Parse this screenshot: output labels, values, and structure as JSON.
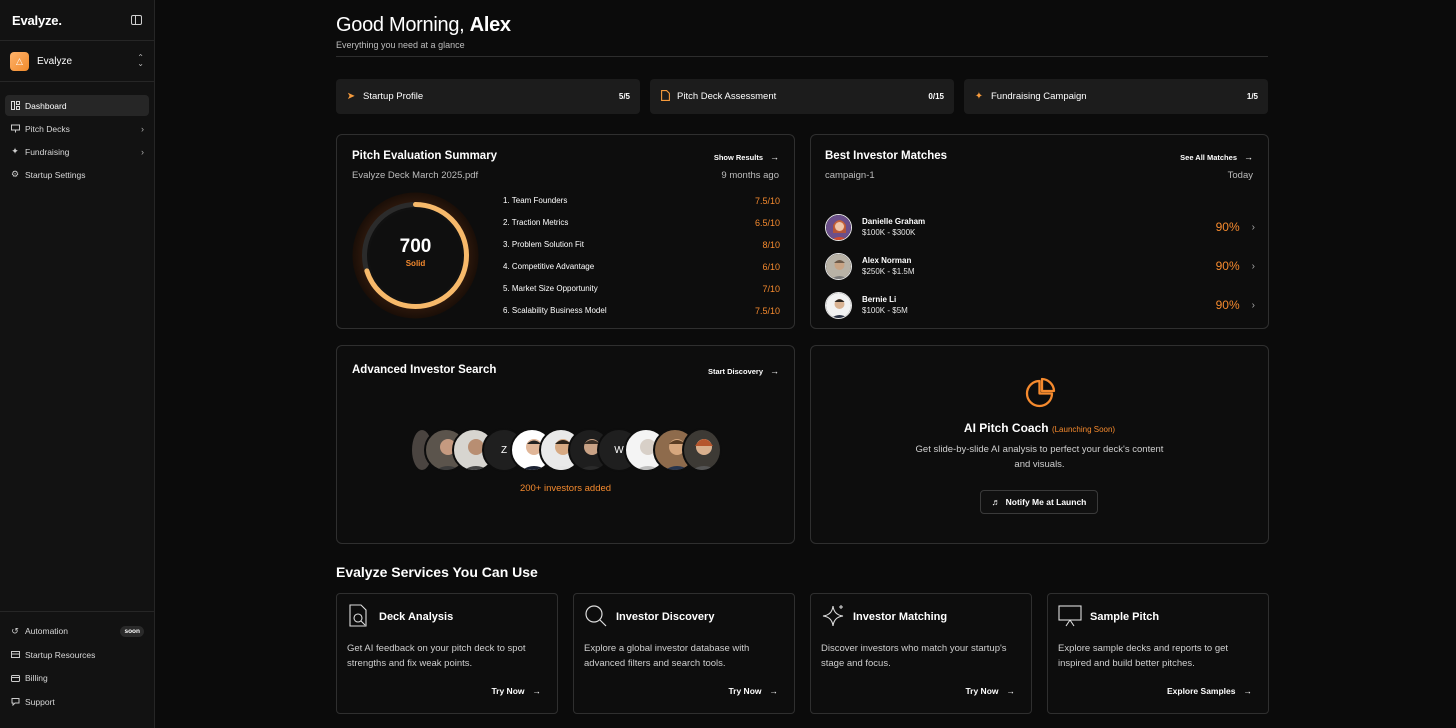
{
  "app": {
    "logo": "Evalyze",
    "logo_dot": "."
  },
  "workspace": {
    "name": "Evalyze",
    "icon": "bell-logo-icon",
    "accent": "#f08a2b"
  },
  "sidebar": {
    "items": [
      {
        "label": "Dashboard",
        "icon": "dashboard-icon",
        "active": true
      },
      {
        "label": "Pitch Decks",
        "icon": "presentation-icon",
        "chevron": true
      },
      {
        "label": "Fundraising",
        "icon": "sparkle-icon",
        "chevron": true
      },
      {
        "label": "Startup Settings",
        "icon": "gear-icon"
      }
    ],
    "bottom": [
      {
        "label": "Automation",
        "icon": "automation-icon",
        "badge": "soon"
      },
      {
        "label": "Startup Resources",
        "icon": "resources-icon"
      },
      {
        "label": "Billing",
        "icon": "card-icon"
      },
      {
        "label": "Support",
        "icon": "support-icon"
      }
    ]
  },
  "header": {
    "greeting": "Good Morning,",
    "name": "Alex",
    "subtitle": "Everything you need at a glance"
  },
  "progress": [
    {
      "label": "Startup Profile",
      "count": "5/5",
      "icon": "rocket-icon"
    },
    {
      "label": "Pitch Deck Assessment",
      "count": "0/15",
      "icon": "document-icon"
    },
    {
      "label": "Fundraising Campaign",
      "count": "1/5",
      "icon": "sparkle-icon"
    }
  ],
  "pitch_eval": {
    "title": "Pitch Evaluation Summary",
    "link": "Show Results",
    "file": "Evalyze Deck March 2025.pdf",
    "time": "9 months ago",
    "score": "700",
    "rating": "Solid",
    "score_fraction": 0.7,
    "metrics": [
      {
        "label": "1. Team Founders",
        "value": "7.5/10"
      },
      {
        "label": "2. Traction Metrics",
        "value": "6.5/10"
      },
      {
        "label": "3. Problem Solution Fit",
        "value": "8/10"
      },
      {
        "label": "4. Competitive Advantage",
        "value": "6/10"
      },
      {
        "label": "5. Market Size Opportunity",
        "value": "7/10"
      },
      {
        "label": "6. Scalability Business Model",
        "value": "7.5/10"
      }
    ]
  },
  "matches": {
    "title": "Best Investor Matches",
    "link": "See All Matches",
    "campaign": "campaign-1",
    "date": "Today",
    "investors": [
      {
        "name": "Danielle Graham",
        "range": "$100K - $300K",
        "pct": "90%"
      },
      {
        "name": "Alex Norman",
        "range": "$250K - $1.5M",
        "pct": "90%"
      },
      {
        "name": "Bernie Li",
        "range": "$100K - $5M",
        "pct": "90%"
      }
    ]
  },
  "search": {
    "title": "Advanced Investor Search",
    "link": "Start Discovery",
    "count_label": "200+ investors added",
    "letters": [
      "Z",
      "W"
    ]
  },
  "coach": {
    "title": "AI Pitch Coach",
    "soon": "(Launching Soon)",
    "desc": "Get slide-by-slide AI analysis to perfect your deck's content and visuals.",
    "button": "Notify Me at Launch"
  },
  "services": {
    "title": "Evalyze Services You Can Use",
    "items": [
      {
        "title": "Deck Analysis",
        "desc": "Get AI feedback on your pitch deck to spot strengths and fix weak points.",
        "action": "Try Now",
        "icon": "document-search-icon"
      },
      {
        "title": "Investor Discovery",
        "desc": "Explore a global investor database with advanced filters and search tools.",
        "action": "Try Now",
        "icon": "search-icon"
      },
      {
        "title": "Investor Matching",
        "desc": "Discover investors who match your startup's stage and focus.",
        "action": "Try Now",
        "icon": "sparkle-icon"
      },
      {
        "title": "Sample Pitch",
        "desc": "Explore sample decks and reports to get inspired and build better pitches.",
        "action": "Explore Samples",
        "icon": "presentation-icon"
      }
    ]
  }
}
